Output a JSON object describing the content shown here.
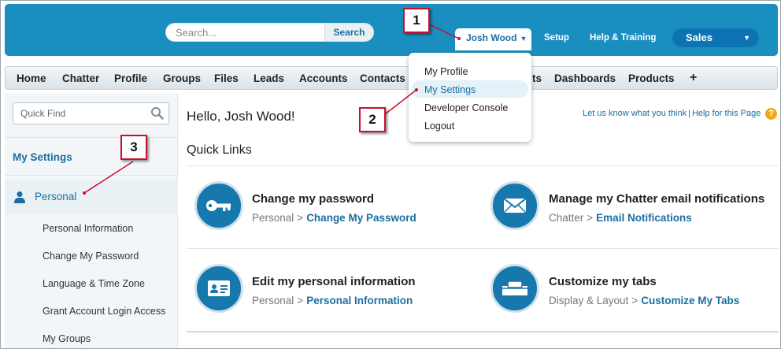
{
  "header": {
    "search_placeholder": "Search...",
    "search_button": "Search",
    "user_name": "Josh Wood",
    "setup_link": "Setup",
    "help_link": "Help & Training",
    "app_name": "Sales"
  },
  "user_dropdown": {
    "items": [
      "My Profile",
      "My Settings",
      "Developer Console",
      "Logout"
    ],
    "selected": "My Settings"
  },
  "tabs": [
    "Home",
    "Chatter",
    "Profile",
    "Groups",
    "Files",
    "Leads",
    "Accounts",
    "Contacts",
    "Dashboards",
    "Products"
  ],
  "tabs_partial": "ts",
  "tabs_more": "+",
  "sidebar": {
    "quickfind_placeholder": "Quick Find",
    "title": "My Settings",
    "personal_label": "Personal",
    "items": [
      "Personal Information",
      "Change My Password",
      "Language & Time Zone",
      "Grant Account Login Access",
      "My Groups"
    ]
  },
  "main": {
    "greeting": "Hello, Josh Wood!",
    "feedback_link": "Let us know what you think",
    "help_page_link": "Help for this Page",
    "help_icon_glyph": "?",
    "quick_links_title": "Quick Links",
    "breadcrumb_separator": ">",
    "cards": [
      {
        "title": "Change my password",
        "crumb": "Personal",
        "link": "Change My Password",
        "icon": "key-icon"
      },
      {
        "title": "Manage my Chatter email notifications",
        "crumb": "Chatter",
        "link": "Email Notifications",
        "icon": "envelope-icon"
      },
      {
        "title": "Edit my personal information",
        "crumb": "Personal",
        "link": "Personal Information",
        "icon": "id-card-icon"
      },
      {
        "title": "Customize my tabs",
        "crumb": "Display & Layout",
        "link": "Customize My Tabs",
        "icon": "tabs-icon"
      }
    ]
  },
  "callouts": [
    "1",
    "2",
    "3"
  ],
  "colors": {
    "header_blue": "#1b8ec0",
    "link_blue": "#1b6fa0",
    "icon_blue": "#1678ad",
    "callout_red": "#c8102e"
  }
}
